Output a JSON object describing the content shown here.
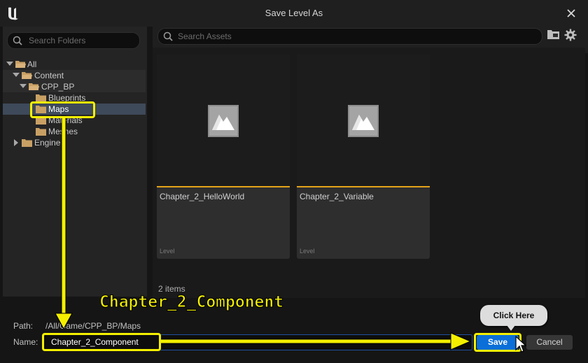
{
  "window": {
    "title": "Save Level As"
  },
  "folders": {
    "search_placeholder": "Search Folders",
    "tree": [
      {
        "label": "All"
      },
      {
        "label": "Content"
      },
      {
        "label": "CPP_BP"
      },
      {
        "label": "Blueprints"
      },
      {
        "label": "Maps"
      },
      {
        "label": "Materials"
      },
      {
        "label": "Meshes"
      },
      {
        "label": "Engine"
      }
    ]
  },
  "assets": {
    "search_placeholder": "Search Assets",
    "items": [
      {
        "name": "Chapter_2_HelloWorld",
        "type": "Level"
      },
      {
        "name": "Chapter_2_Variable",
        "type": "Level"
      }
    ],
    "count_text": "2 items"
  },
  "footer": {
    "path_label": "Path:",
    "path_value": "/All/Game/CPP_BP/Maps",
    "name_label": "Name:",
    "name_value": "Chapter_2_Component",
    "save_label": "Save",
    "cancel_label": "Cancel"
  },
  "annotations": {
    "big_text": "Chapter_2_Component",
    "tooltip": "Click Here",
    "color": "#f4f000"
  },
  "colors": {
    "accent_blue": "#0a6fd8",
    "asset_underline": "#e4a21a",
    "folder": "#c9a064"
  }
}
